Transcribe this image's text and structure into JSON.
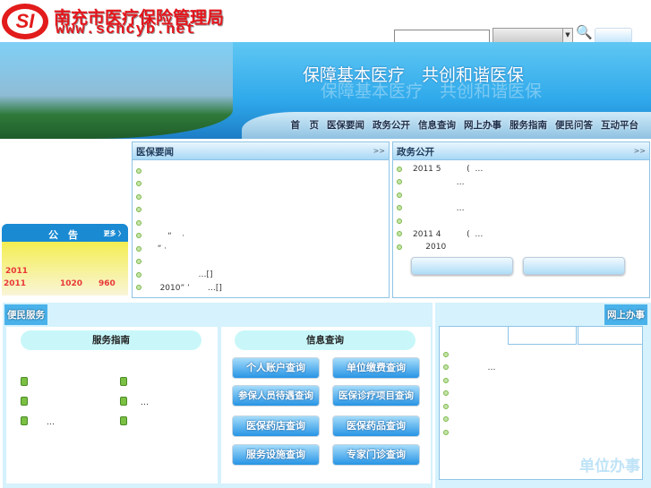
{
  "header": {
    "logo_mark": "SI",
    "site_title": "南充市医疗保险管理局",
    "site_url": "www.scncyb.net",
    "search_placeholder": "",
    "search_button": ""
  },
  "banner": {
    "slogan": "保障基本医疗　共创和谐医保"
  },
  "nav": [
    "首　页",
    "医保要闻",
    "政务公开",
    "信息查询",
    "网上办事",
    "服务指南",
    "便民问答",
    "互动平台"
  ],
  "notice": {
    "title": "公　告",
    "more": "更多 〉",
    "lines": [
      "2011",
      "2011",
      "1020",
      "960"
    ]
  },
  "news": {
    "title": "医保要闻",
    "more": ">>",
    "items": [
      "",
      "",
      "",
      "",
      "",
      "      “    ·",
      "  “ ·",
      "",
      "                  …[]",
      "   2010” ’       …[]"
    ]
  },
  "gov": {
    "title": "政务公开",
    "more": ">>",
    "items": [
      "2011 5          (  …",
      "                 …",
      "",
      "                 …",
      "",
      "2011 4          (  …",
      "     2010"
    ]
  },
  "service": {
    "tag": "便民服务",
    "guide_title": "服务指南",
    "guide_items": [
      "",
      "",
      "",
      "…",
      "…",
      ""
    ]
  },
  "query": {
    "title": "信息查询",
    "buttons": [
      "个人账户查询",
      "单位缴费查询",
      "参保人员待遇查询",
      "医保诊疗项目查询",
      "医保药店查询",
      "医保药品查询",
      "服务设施查询",
      "专家门诊查询"
    ]
  },
  "online": {
    "tag": "网上办事",
    "items": [
      "",
      "           …",
      "",
      "",
      "",
      "",
      ""
    ],
    "watermark": "单位办事"
  }
}
